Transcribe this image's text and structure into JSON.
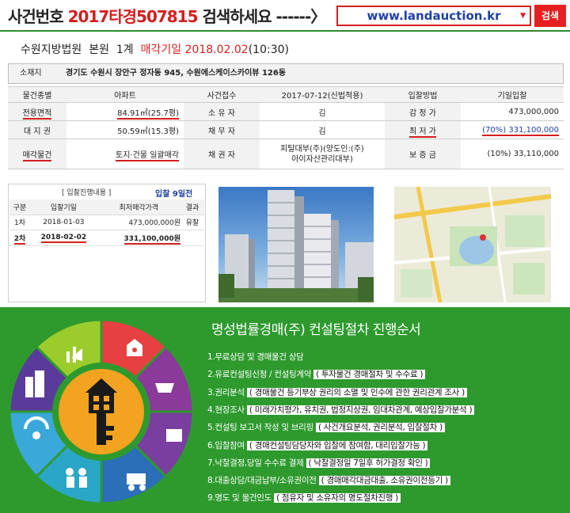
{
  "header": {
    "label_prefix": "사건번호",
    "case_number": "2017타경507815",
    "label_suffix": "검색하세요 ------〉",
    "site_select": "www.landauction.kr",
    "search_button": "검색"
  },
  "court_line": {
    "court": "수원지방법원",
    "branch": "본원",
    "division": "1계",
    "sale_date_label": "매각기일",
    "sale_date": "2018.02.02",
    "sale_time": "(10:30)"
  },
  "address": {
    "label": "소재지",
    "value": "경기도 수원시 장안구 정자동 945, 수원에스케이스카이뷰 126동"
  },
  "info": {
    "row1": {
      "k1": "물건종별",
      "v1": "아파트",
      "k2": "사건접수",
      "v2": "2017-07-12(신법적용)",
      "k3": "입찰방법",
      "v3": "기일입찰"
    },
    "row2": {
      "k1": "전용면적",
      "v1": "84.91㎡(25.7평)",
      "k2": "소 유 자",
      "v2": "김",
      "k3": "감 정 가",
      "v3": "473,000,000"
    },
    "row3": {
      "k1": "대 지 권",
      "v1": "50.59㎡(15.3평)",
      "k2": "채 무 자",
      "v2": "김",
      "k3": "최 저 가",
      "v3": "(70%)  331,100,000"
    },
    "row4": {
      "k1": "매각물건",
      "v1": "토지·건물 일괄매각",
      "k2": "채 권 자",
      "v2a": "피탈대부(주)(양도인:(주)",
      "v2b": "아이자산관리대부)",
      "k3": "보 증 금",
      "v3": "(10%)  33,110,000"
    }
  },
  "bid_history": {
    "title": "[ 입찰진행내용 ]",
    "round_info": "입찰 9일전",
    "headers": [
      "구분",
      "입찰기일",
      "최저매각가격",
      "결과"
    ],
    "rows": [
      [
        "1차",
        "2018-01-03",
        "473,000,000원",
        "유찰"
      ],
      [
        "2차",
        "2018-02-02",
        "331,100,000원",
        ""
      ]
    ]
  },
  "consult": {
    "title": "명성법률경매(주) 컨설팅절차 진행순서",
    "steps": [
      {
        "a": "1.무료상담 및 경매물건 상담",
        "b": ""
      },
      {
        "a": "2.유료컨설팅신청 / 컨설팅계약",
        "b": "( 투자물건 경매절차 및 수수료 )"
      },
      {
        "a": "3.권리분석",
        "b": "( 경매물건 등기부상 권리의 소멸 및 인수에 관한 권리관계 조사 )"
      },
      {
        "a": "4.현장조사",
        "b": "( 미래가치평가, 유치권, 법정지상권, 임대차관계, 예상입찰가분석 )"
      },
      {
        "a": "5.컨설팅 보고서 작성 및 브리핑",
        "b": "( 사건개요분석, 권리분석, 입찰절차 )"
      },
      {
        "a": "6.입찰참여",
        "b": "( 경매컨설팅담당자와 입찰에 참여함, 대리입찰가능 )"
      },
      {
        "a": "7.낙찰결정,당일 수수료 결제",
        "b": "( 낙찰결정일 7일후 허가결정 확인 )"
      },
      {
        "a": "8.대출상담/대금납부/소유권이전",
        "b": "( 경매매각대금대출, 소유권이전등기 )"
      },
      {
        "a": "9.명도 및 물건인도",
        "b": "( 점유자 및 소유자의 명도절차진행 )"
      }
    ]
  },
  "colors": {
    "accent_red": "#d41e1e",
    "accent_blue": "#1e3fa8",
    "green_bg": "#2e9a2e"
  }
}
